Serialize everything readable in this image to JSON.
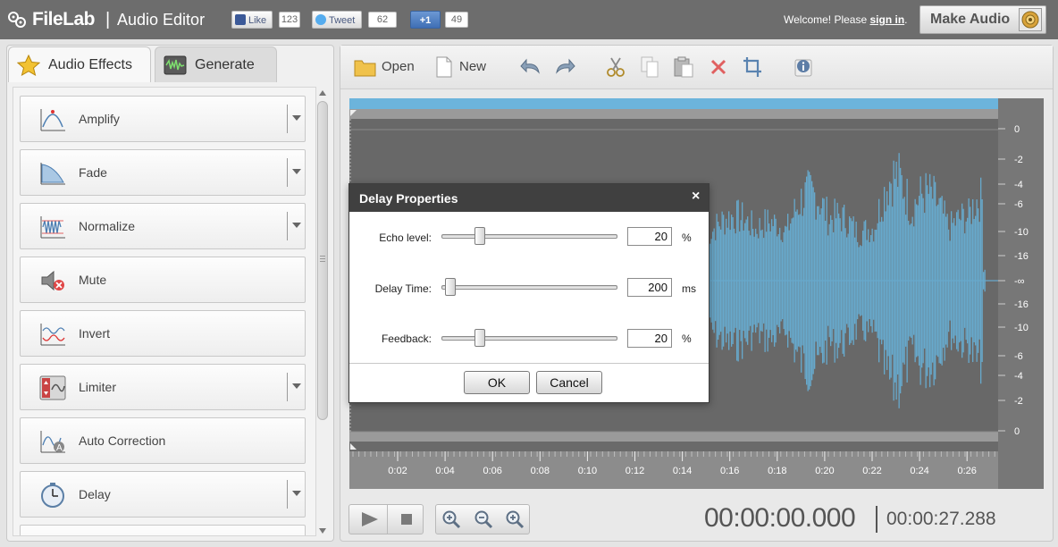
{
  "brand": {
    "name": "FileLab",
    "separator": "|",
    "app": "Audio Editor"
  },
  "social": {
    "like_label": "Like",
    "like_count": "123",
    "tweet_label": "Tweet",
    "tweet_count": "62",
    "plus_label": "+1",
    "plus_count": "49"
  },
  "header": {
    "welcome_prefix": "Welcome! Please ",
    "sign_in": "sign in",
    "welcome_suffix": ".",
    "make_audio": "Make Audio"
  },
  "left_tabs": [
    {
      "label": "Audio Effects",
      "icon": "star-icon"
    },
    {
      "label": "Generate",
      "icon": "waveform-generator-icon"
    }
  ],
  "effects": [
    {
      "label": "Amplify",
      "icon": "amplify-icon",
      "has_dropdown": true
    },
    {
      "label": "Fade",
      "icon": "fade-icon",
      "has_dropdown": true
    },
    {
      "label": "Normalize",
      "icon": "normalize-icon",
      "has_dropdown": true
    },
    {
      "label": "Mute",
      "icon": "mute-icon",
      "has_dropdown": false
    },
    {
      "label": "Invert",
      "icon": "invert-icon",
      "has_dropdown": false
    },
    {
      "label": "Limiter",
      "icon": "limiter-icon",
      "has_dropdown": true
    },
    {
      "label": "Auto Correction",
      "icon": "auto-correction-icon",
      "has_dropdown": false
    },
    {
      "label": "Delay",
      "icon": "delay-clock-icon",
      "has_dropdown": true
    }
  ],
  "toolbar": {
    "open_label": "Open",
    "new_label": "New"
  },
  "waveform": {
    "time_ticks": [
      "0:02",
      "0:04",
      "0:06",
      "0:08",
      "0:10",
      "0:12",
      "0:14",
      "0:16",
      "0:18",
      "0:20",
      "0:22",
      "0:24",
      "0:26"
    ],
    "db_ticks": [
      "0",
      "-2",
      "-4",
      "-6",
      "-10",
      "-16",
      "-∞",
      "-16",
      "-10",
      "-6",
      "-4",
      "-2",
      "0"
    ],
    "wave_color": "#67a9cc"
  },
  "transport": {
    "current_time": "00:00:00.000",
    "total_time": "00:00:27.288"
  },
  "dialog": {
    "title": "Delay Properties",
    "close": "×",
    "params": [
      {
        "label": "Echo level:",
        "value": "20",
        "unit": "%",
        "fraction": 0.2
      },
      {
        "label": "Delay Time:",
        "value": "200",
        "unit": "ms",
        "fraction": 0.02
      },
      {
        "label": "Feedback:",
        "value": "20",
        "unit": "%",
        "fraction": 0.2
      }
    ],
    "ok_label": "OK",
    "cancel_label": "Cancel"
  },
  "colors": {
    "topbar": "#6d6d6d",
    "accent_blue": "#67a9cc",
    "dialog_title": "#404040"
  }
}
